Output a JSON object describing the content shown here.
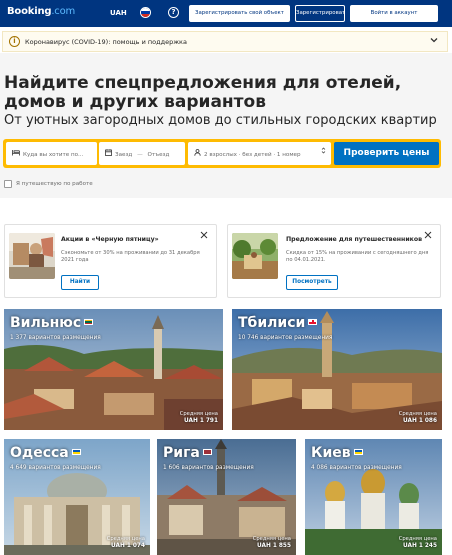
{
  "header": {
    "logo_main": "Booking",
    "logo_domain": ".com",
    "currency": "UAH",
    "help_glyph": "?",
    "register_property": "Зарегистрировать свой объект",
    "register": "Зарегистрироваться",
    "sign_in": "Войти в аккаунт",
    "language_flag": "flag-ru-icon"
  },
  "covid": {
    "icon_glyph": "i",
    "text": "Коронавирус (COVID-19): помощь и поддержка"
  },
  "hero": {
    "title": "Найдите спецпредложения для отелей, домов и других вариантов",
    "subtitle": "От уютных загородных домов до стильных городских квартир"
  },
  "search": {
    "destination_placeholder": "Куда вы хотите по...",
    "checkin": "Заезд",
    "arrow": "—",
    "checkout": "Отъезд",
    "guests": "2 взрослых · без детей · 1 номер",
    "submit": "Проверить цены",
    "work_travel_label": "Я путешествую по работе"
  },
  "promos": [
    {
      "title": "Акции в «Черную пятницу»",
      "desc": "Сэкономьте от 30% на проживании до 31 декабря 2021 года",
      "button": "Найти"
    },
    {
      "title": "Предложение для путешественников",
      "desc": "Скидка от 15% на проживании с сегодняшнего дня по 04.01.2021.",
      "button": "Посмотреть"
    }
  ],
  "price_label": "Средняя цена",
  "destinations": [
    {
      "name": "Вильнюс",
      "count": "1 377 вариантов размещения",
      "price": "UAH 1 791"
    },
    {
      "name": "Тбилиси",
      "count": "10 746 вариантов размещения",
      "price": "UAH 1 086"
    },
    {
      "name": "Одесса",
      "count": "4 649 вариантов размещения",
      "price": "UAH 1 074"
    },
    {
      "name": "Рига",
      "count": "1 606 вариантов размещения",
      "price": "UAH 1 855"
    },
    {
      "name": "Киев",
      "count": "4 086 вариантов размещения",
      "price": "UAH 1 245"
    }
  ],
  "colors": {
    "brand_blue": "#003580",
    "accent_yellow": "#febb02",
    "button_blue": "#0071c2"
  }
}
